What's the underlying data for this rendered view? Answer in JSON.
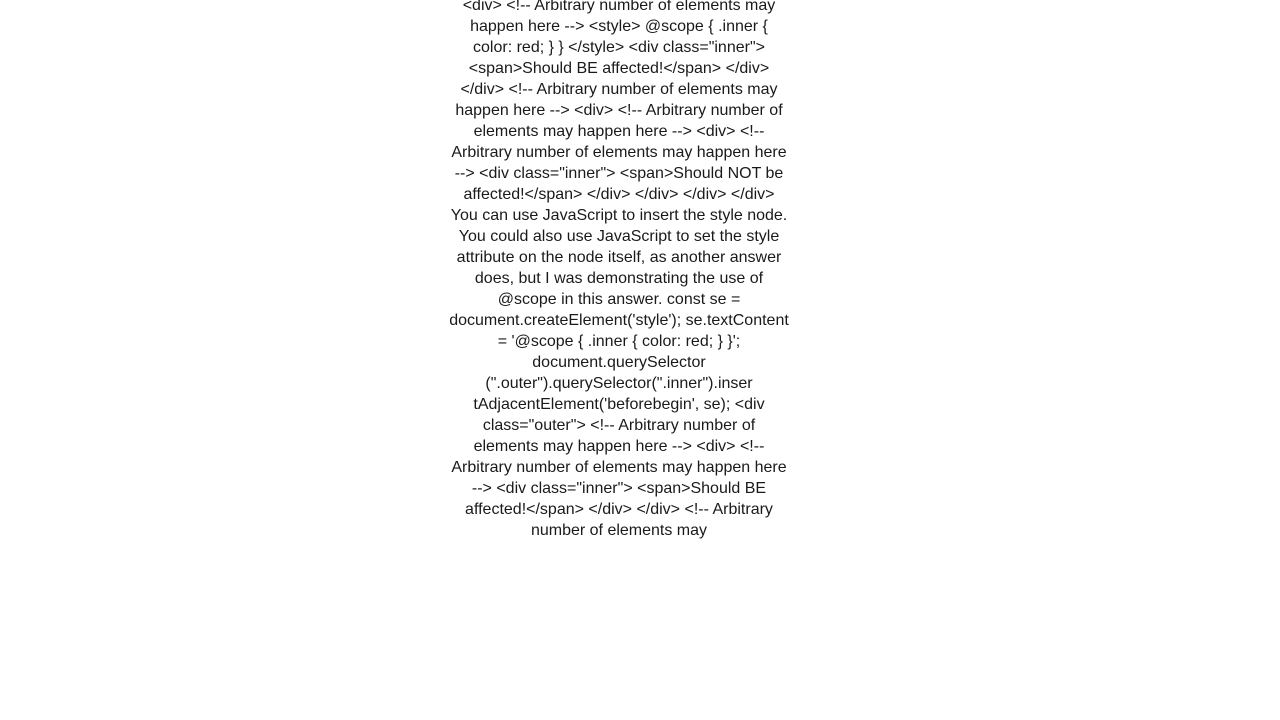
{
  "text": "<div>         <!-- Arbitrary number of elements may happen here -->         <style>           @scope {             .inner {               color: red;             }           }         </style>         <div class=\"inner\">           <span>Should BE affected!</span>         </div>     </div>     <!-- Arbitrary number of elements may happen here -->     <div>         <!-- Arbitrary number of elements may happen here -->         <div>           <!-- Arbitrary number of elements may happen here -->           <div class=\"inner\">             <span>Should NOT be affected!</span>           </div>         </div>     </div>   </div>   You can use JavaScript to insert the style node. You could also use JavaScript to set the style attribute on the node itself, as another answer does, but I was demonstrating the use of @scope in this answer.   const se = document.createElement('style'); se.textContent = '@scope { .inner { color: red; } }'; document.querySelector (\".outer\").querySelector(\".inner\").inser tAdjacentElement('beforebegin', se);   <div class=\"outer\">     <!-- Arbitrary number of elements may happen here -->     <div>         <!-- Arbitrary number of elements may happen here -->         <div class=\"inner\">           <span>Should BE affected!</span>         </div>     </div>     <!-- Arbitrary number of elements may"
}
